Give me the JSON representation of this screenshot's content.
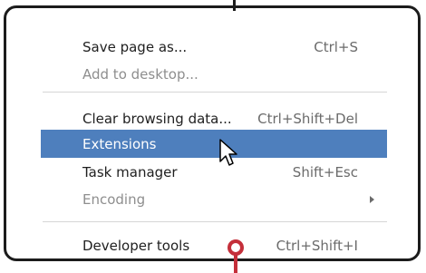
{
  "menu": {
    "items": [
      {
        "label": "Save page as...",
        "shortcut": "Ctrl+S"
      },
      {
        "label": "Add to desktop...",
        "shortcut": ""
      },
      {
        "label": "Clear browsing data...",
        "shortcut": "Ctrl+Shift+Del"
      },
      {
        "label": "Extensions",
        "shortcut": ""
      },
      {
        "label": "Task manager",
        "shortcut": "Shift+Esc"
      },
      {
        "label": "Encoding",
        "shortcut": ""
      },
      {
        "label": "Developer tools",
        "shortcut": "Ctrl+Shift+I"
      }
    ]
  },
  "colors": {
    "highlight": "#4e7fbd",
    "frame": "#1c1c1c",
    "pin": "#c42f3a",
    "disabled_text": "#8e8e8e"
  },
  "icons": {
    "cursor": "mouse-pointer-icon",
    "pin": "location-pin-icon",
    "submenu": "submenu-arrow-icon"
  }
}
